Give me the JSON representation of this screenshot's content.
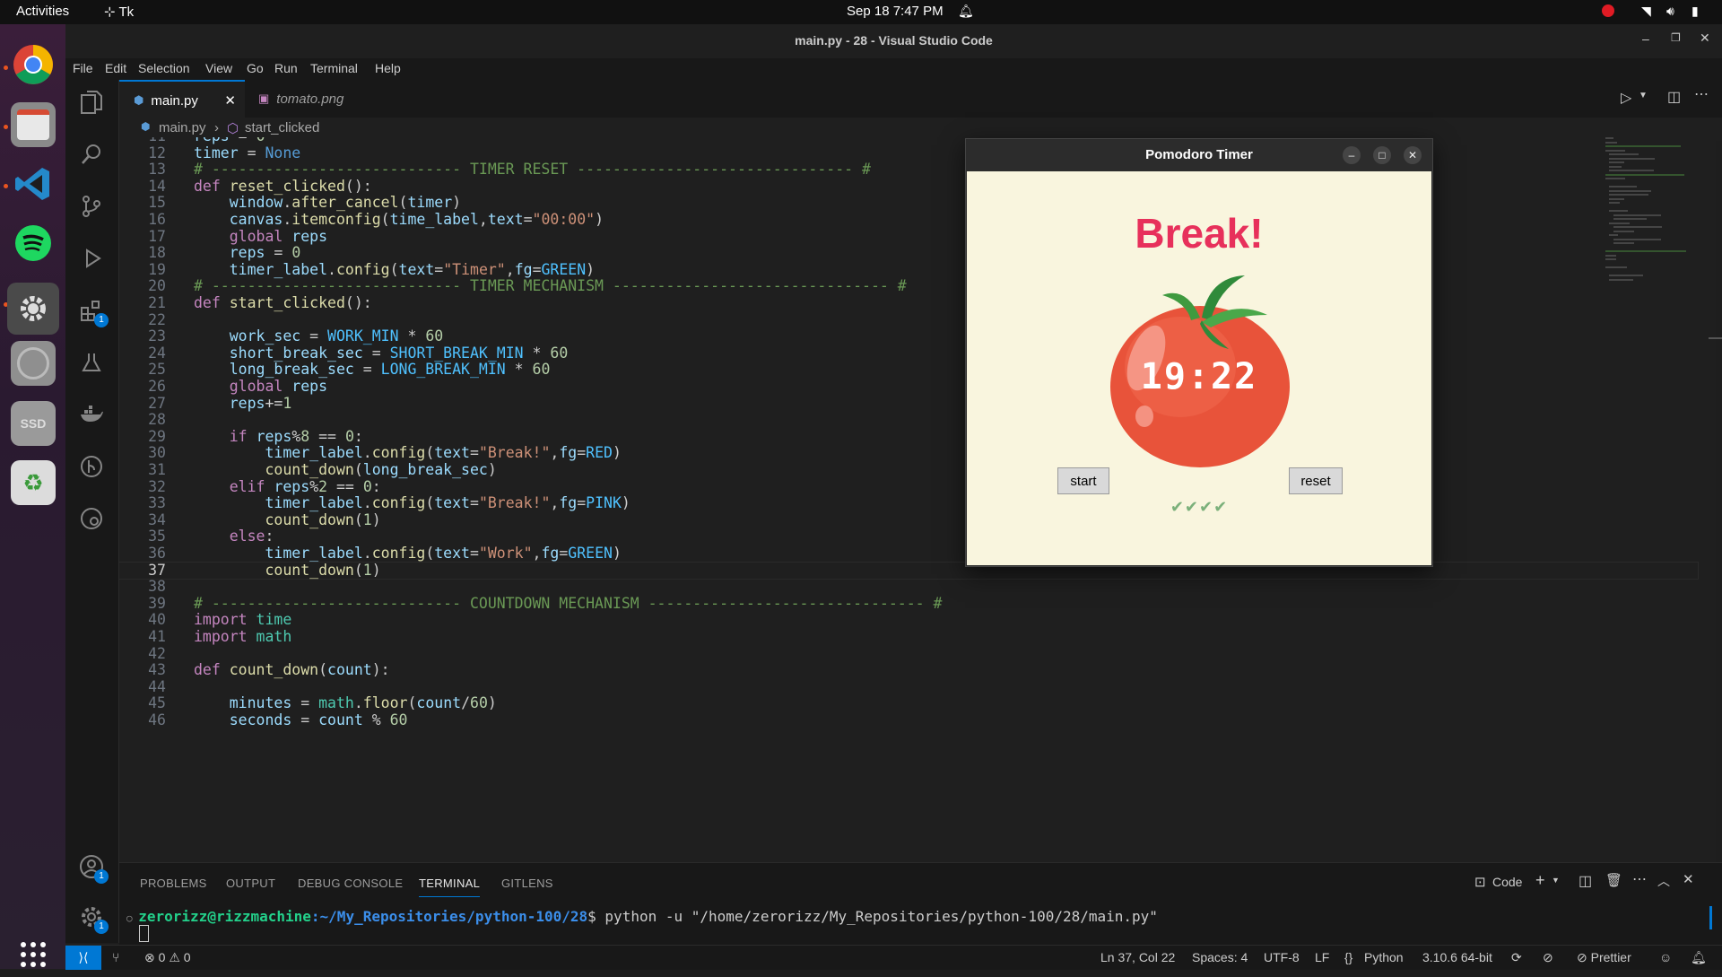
{
  "topbar": {
    "activities": "Activities",
    "app": "Tk",
    "datetime": "Sep 18  7:47 PM"
  },
  "window": {
    "title": "main.py - 28 - Visual Studio Code"
  },
  "menu": [
    "File",
    "Edit",
    "Selection",
    "View",
    "Go",
    "Run",
    "Terminal",
    "Help"
  ],
  "tabs": [
    {
      "label": "main.py",
      "active": true
    },
    {
      "label": "tomato.png",
      "active": false
    }
  ],
  "breadcrumb": {
    "file": "main.py",
    "symbol": "start_clicked"
  },
  "activity_badges": {
    "extensions": "1",
    "accounts": "1",
    "settings": "1"
  },
  "code_lines": [
    {
      "n": "11",
      "t": "reps = 0"
    },
    {
      "n": "12",
      "t": "timer = None"
    },
    {
      "n": "13",
      "t": "# ---------------------------- TIMER RESET ------------------------------- #"
    },
    {
      "n": "14",
      "t": "def reset_clicked():"
    },
    {
      "n": "15",
      "t": "    window.after_cancel(timer)"
    },
    {
      "n": "16",
      "t": "    canvas.itemconfig(time_label,text=\"00:00\")"
    },
    {
      "n": "17",
      "t": "    global reps"
    },
    {
      "n": "18",
      "t": "    reps = 0"
    },
    {
      "n": "19",
      "t": "    timer_label.config(text=\"Timer\",fg=GREEN)"
    },
    {
      "n": "20",
      "t": "# ---------------------------- TIMER MECHANISM ------------------------------- #"
    },
    {
      "n": "21",
      "t": "def start_clicked():"
    },
    {
      "n": "22",
      "t": ""
    },
    {
      "n": "23",
      "t": "    work_sec = WORK_MIN * 60"
    },
    {
      "n": "24",
      "t": "    short_break_sec = SHORT_BREAK_MIN * 60"
    },
    {
      "n": "25",
      "t": "    long_break_sec = LONG_BREAK_MIN * 60"
    },
    {
      "n": "26",
      "t": "    global reps"
    },
    {
      "n": "27",
      "t": "    reps+=1"
    },
    {
      "n": "28",
      "t": ""
    },
    {
      "n": "29",
      "t": "    if reps%8 == 0:"
    },
    {
      "n": "30",
      "t": "        timer_label.config(text=\"Break!\",fg=RED)"
    },
    {
      "n": "31",
      "t": "        count_down(long_break_sec)"
    },
    {
      "n": "32",
      "t": "    elif reps%2 == 0:"
    },
    {
      "n": "33",
      "t": "        timer_label.config(text=\"Break!\",fg=PINK)"
    },
    {
      "n": "34",
      "t": "        count_down(1)"
    },
    {
      "n": "35",
      "t": "    else:"
    },
    {
      "n": "36",
      "t": "        timer_label.config(text=\"Work\",fg=GREEN)"
    },
    {
      "n": "37",
      "t": "        count_down(1)"
    },
    {
      "n": "38",
      "t": ""
    },
    {
      "n": "39",
      "t": "# ---------------------------- COUNTDOWN MECHANISM ------------------------------- #"
    },
    {
      "n": "40",
      "t": "import time"
    },
    {
      "n": "41",
      "t": "import math"
    },
    {
      "n": "42",
      "t": ""
    },
    {
      "n": "43",
      "t": "def count_down(count):"
    },
    {
      "n": "44",
      "t": ""
    },
    {
      "n": "45",
      "t": "    minutes = math.floor(count/60)"
    },
    {
      "n": "46",
      "t": "    seconds = count % 60"
    }
  ],
  "current_line": "37",
  "panel": {
    "tabs": [
      "PROBLEMS",
      "OUTPUT",
      "DEBUG CONSOLE",
      "TERMINAL",
      "GITLENS"
    ],
    "active_tab": "TERMINAL",
    "terminal_profile": "Code",
    "prompt_user": "zerorizz@rizzmachine",
    "prompt_path": ":~/My_Repositories/python-100/28",
    "prompt_cmd": "$ python -u \"/home/zerorizz/My_Repositories/python-100/28/main.py\""
  },
  "status": {
    "errors": "0",
    "warnings": "0",
    "position": "Ln 37, Col 22",
    "spaces": "Spaces: 4",
    "encoding": "UTF-8",
    "eol": "LF",
    "language": "Python",
    "interpreter": "3.10.6 64-bit",
    "formatter": "Prettier"
  },
  "tk_app": {
    "title": "Pomodoro Timer",
    "label": "Break!",
    "time": "19:22",
    "start": "start",
    "reset": "reset",
    "checks": "✔✔✔✔",
    "label_color": "#e7305b",
    "bg_color": "#f9f5de"
  },
  "colors": {
    "accent": "#0078d4",
    "ubuntu_orange": "#e95420"
  },
  "icons": [
    "chrome-icon",
    "files-icon",
    "vscode-icon",
    "spotify-icon",
    "settings-icon",
    "disk-icon",
    "ssd-icon",
    "trash-icon",
    "app-grid-icon"
  ]
}
